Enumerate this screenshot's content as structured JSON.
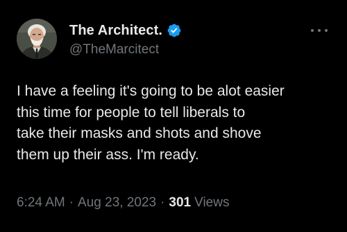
{
  "tweet": {
    "author": {
      "display_name": "The Architect.",
      "handle": "@TheMarcitect",
      "verified": true,
      "verified_icon": "verified-badge-icon",
      "avatar_icon": "avatar"
    },
    "more_icon": "more-options-icon",
    "text": "I have a feeling it's going to be alot easier\nthis time for people to tell liberals to\ntake their masks and shots and shove\nthem up their ass. I'm ready.",
    "time": "6:24 AM",
    "separator": "·",
    "date": "Aug 23, 2023",
    "views_count": "301",
    "views_label": "Views"
  },
  "colors": {
    "background": "#000000",
    "primary_text": "#e7e9ea",
    "secondary_text": "#71767b",
    "verified_blue": "#1d9bf0"
  }
}
